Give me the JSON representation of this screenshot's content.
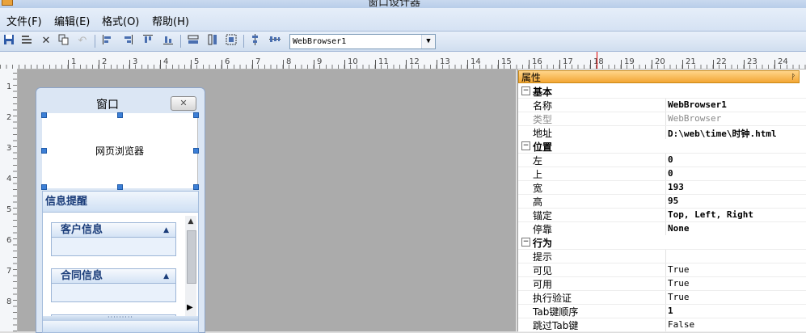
{
  "window": {
    "title": "窗口设计器"
  },
  "menu": [
    {
      "label": "文件(F)",
      "id": "file"
    },
    {
      "label": "编辑(E)",
      "id": "edit"
    },
    {
      "label": "格式(O)",
      "id": "format"
    },
    {
      "label": "帮助(H)",
      "id": "help"
    }
  ],
  "toolbar": {
    "icons": [
      "save-icon",
      "save-all-icon",
      "delete-icon",
      "copy-icon",
      "undo-icon",
      "align-left-icon",
      "align-right-icon",
      "align-top-icon",
      "align-bottom-icon",
      "same-width-icon",
      "same-height-icon",
      "same-size-icon",
      "center-vertical-icon",
      "center-horizontal-icon"
    ],
    "component_select": "WebBrowser1"
  },
  "ruler": {
    "h_numbers": [
      "1",
      "2",
      "3",
      "4",
      "5",
      "6",
      "7",
      "8",
      "9",
      "10",
      "11",
      "12",
      "13",
      "14",
      "15",
      "16",
      "17",
      "18",
      "19",
      "20",
      "21",
      "22",
      "23",
      "24"
    ],
    "v_numbers": [
      "1",
      "2",
      "3",
      "4",
      "5",
      "6",
      "7",
      "8"
    ]
  },
  "designer": {
    "form_title": "窗口",
    "close_glyph": "✕",
    "browser_label": "网页浏览器",
    "panel_title": "信息提醒",
    "groups": [
      {
        "title": "客户信息"
      },
      {
        "title": "合同信息"
      }
    ],
    "splitter_glyph": "·········"
  },
  "properties": {
    "title": "属性",
    "pin_glyph": "ᚹ",
    "rows": [
      {
        "type": "category",
        "label": "基本",
        "toggle": "−"
      },
      {
        "type": "prop",
        "name": "名称",
        "value": "WebBrowser1",
        "style": "bold"
      },
      {
        "type": "prop",
        "name": "类型",
        "value": "WebBrowser",
        "style": "disabled"
      },
      {
        "type": "prop",
        "name": "地址",
        "value": "D:\\web\\time\\时钟.html",
        "style": "bold"
      },
      {
        "type": "category",
        "label": "位置",
        "toggle": "−"
      },
      {
        "type": "prop",
        "name": "左",
        "value": "0",
        "style": "bold"
      },
      {
        "type": "prop",
        "name": "上",
        "value": "0",
        "style": "bold"
      },
      {
        "type": "prop",
        "name": "宽",
        "value": "193",
        "style": "bold"
      },
      {
        "type": "prop",
        "name": "高",
        "value": "95",
        "style": "bold"
      },
      {
        "type": "prop",
        "name": "锚定",
        "value": "Top, Left, Right",
        "style": "bold"
      },
      {
        "type": "prop",
        "name": "停靠",
        "value": "None",
        "style": "bold"
      },
      {
        "type": "category",
        "label": "行为",
        "toggle": "−"
      },
      {
        "type": "prop",
        "name": "提示",
        "value": "",
        "style": "normal"
      },
      {
        "type": "prop",
        "name": "可见",
        "value": "True",
        "style": "normal"
      },
      {
        "type": "prop",
        "name": "可用",
        "value": "True",
        "style": "normal"
      },
      {
        "type": "prop",
        "name": "执行验证",
        "value": "True",
        "style": "normal"
      },
      {
        "type": "prop",
        "name": "Tab键顺序",
        "value": "1",
        "style": "bold"
      },
      {
        "type": "prop",
        "name": "跳过Tab键",
        "value": "False",
        "style": "normal"
      }
    ]
  }
}
